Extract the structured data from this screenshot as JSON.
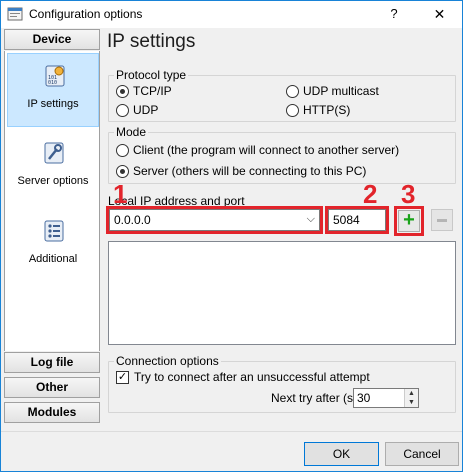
{
  "window": {
    "title": "Configuration options",
    "help_glyph": "?",
    "close_glyph": "✕"
  },
  "sidebar": {
    "device_header": "Device",
    "items": [
      {
        "label": "IP settings",
        "icon": "ip-settings-icon",
        "active": true
      },
      {
        "label": "Server options",
        "icon": "wrench-icon",
        "active": false
      },
      {
        "label": "Additional",
        "icon": "list-options-icon",
        "active": false
      }
    ],
    "bottom_headers": [
      "Log file",
      "Other",
      "Modules"
    ]
  },
  "main": {
    "title": "IP settings",
    "protocol": {
      "group_label": "Protocol type",
      "options": [
        "TCP/IP",
        "UDP multicast",
        "UDP",
        "HTTP(S)"
      ],
      "selected": "TCP/IP"
    },
    "mode": {
      "group_label": "Mode",
      "options": [
        "Client (the program will connect to another server)",
        "Server (others will be connecting to this PC)"
      ],
      "selected": "Server (others will be connecting to this PC)"
    },
    "local": {
      "label": "Local IP address and port",
      "ip_value": "0.0.0.0",
      "port_value": "5084"
    },
    "annotations": [
      "1",
      "2",
      "3"
    ],
    "connection": {
      "group_label": "Connection options",
      "retry_label": "Try to connect after an unsuccessful attempt",
      "retry_checked": true,
      "next_try_label": "Next try after (s)",
      "next_try_value": "30"
    }
  },
  "footer": {
    "ok_label": "OK",
    "cancel_label": "Cancel"
  },
  "colors": {
    "accent": "#0078d7",
    "annotation_red": "#e2242b",
    "add_green": "#1aa31a"
  }
}
